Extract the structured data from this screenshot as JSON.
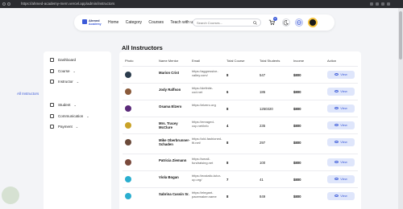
{
  "browser": {
    "url": "https://ahmed-academy-mern.vercel.app/admin/instructors"
  },
  "brand": {
    "line1": "Ahmed",
    "line2": "Academy"
  },
  "nav": {
    "links": [
      "Home",
      "Category",
      "Courses",
      "Teach with us"
    ],
    "search_placeholder": "Search Courses...",
    "cart_count": "0",
    "icons": [
      "cart-icon",
      "moon-icon",
      "globe-icon",
      "search-icon"
    ]
  },
  "page": {
    "title": "All Instructors"
  },
  "sidebar": {
    "items": [
      {
        "label": "Dashboard",
        "icon": "dashboard-icon"
      },
      {
        "label": "Course",
        "icon": "book-icon"
      },
      {
        "label": "Instructor",
        "icon": "user-icon"
      },
      {
        "label": "Student",
        "icon": "student-icon"
      },
      {
        "label": "Communication",
        "icon": "chat-icon"
      },
      {
        "label": "Payment",
        "icon": "wallet-icon"
      }
    ],
    "sub_item": "All Instructors"
  },
  "table": {
    "headers": [
      "Photo",
      "Name Mentor",
      "Email",
      "Total Course",
      "Total Students",
      "Income",
      "Action"
    ],
    "view_label": "View",
    "rows": [
      {
        "name": "Marion Crist",
        "email": "https://aggressive-valley.com/",
        "courses": "8",
        "students": "547",
        "income": "$800",
        "color": "#2a3b4c"
      },
      {
        "name": "Jody Raffson",
        "email": "https://definite-cod.net",
        "courses": "6",
        "students": "186",
        "income": "$800",
        "color": "#8a5a3a"
      },
      {
        "name": "Osama Elzero",
        "email": "https://elzero.org",
        "courses": "8",
        "students": "1250320",
        "income": "$800",
        "color": "#5b2a7a"
      },
      {
        "name": "Mrs. Tracey McClure",
        "email": "https://enraged-cop.net/info",
        "courses": "4",
        "students": "235",
        "income": "$800",
        "color": "#c9a227"
      },
      {
        "name": "Mike Oberbrunner-Schaden",
        "email": "https://old-fashioned-fit.net/",
        "courses": "8",
        "students": "297",
        "income": "$800",
        "color": "#6b4a3a"
      },
      {
        "name": "Patricia Ziemann",
        "email": "https://small-fundraising.net",
        "courses": "8",
        "students": "100",
        "income": "$800",
        "color": "#7a4a3c"
      },
      {
        "name": "Viola Bogan",
        "email": "https://ecstatic-tutor-up.org/",
        "courses": "7",
        "students": "41",
        "income": "$800",
        "color": "#2aaecf"
      },
      {
        "name": "Sabrina Cassin Sr.",
        "email": "https://elegant-pacemaker.name",
        "courses": "8",
        "students": "849",
        "income": "$800",
        "color": "#2aaecf"
      }
    ]
  }
}
